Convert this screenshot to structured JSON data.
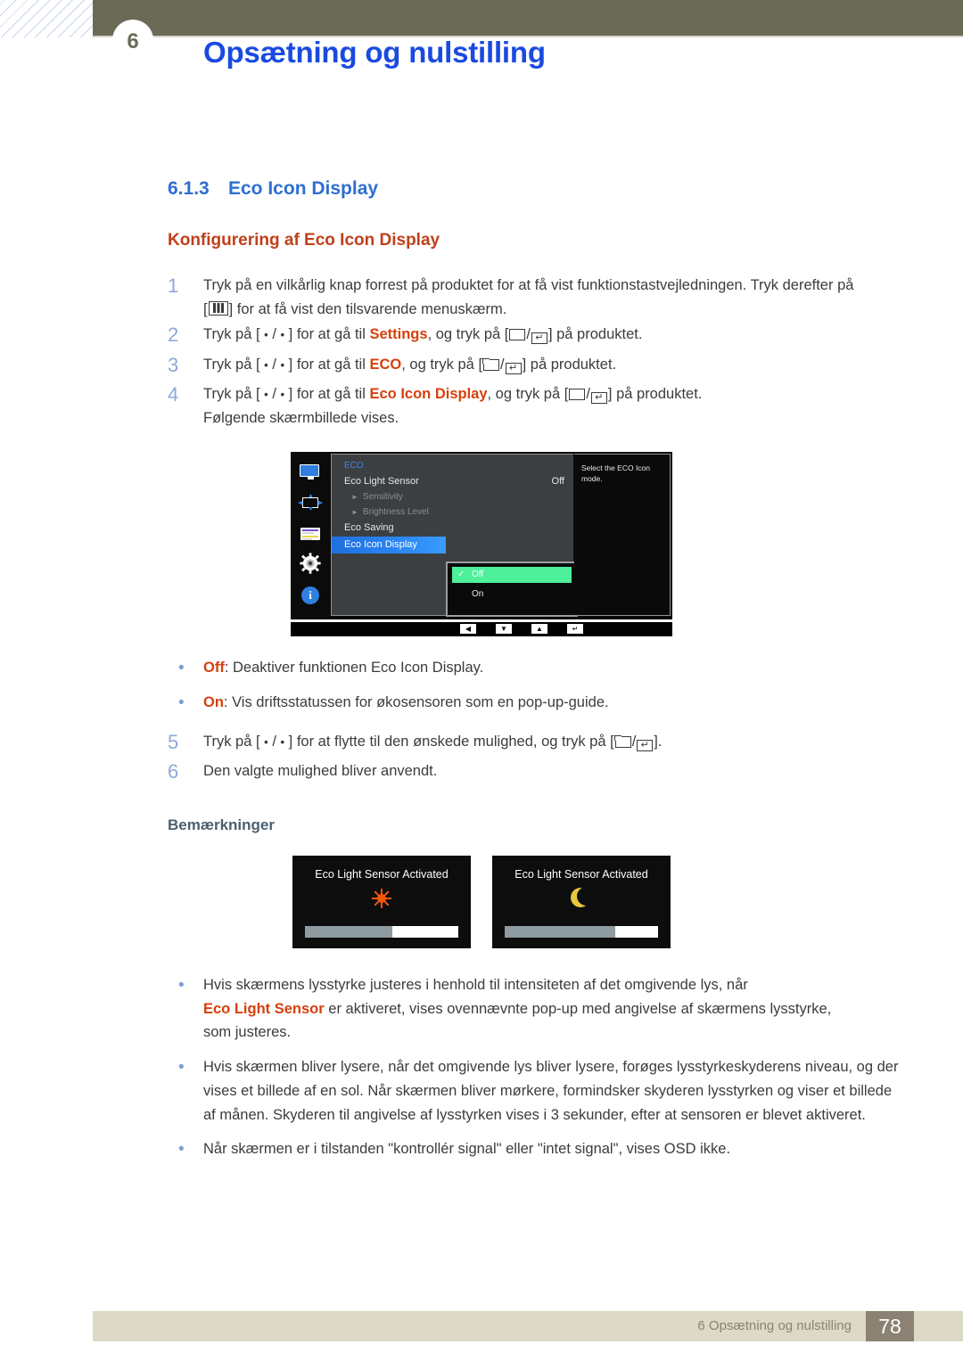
{
  "header": {
    "chapter_number": "6",
    "title": "Opsætning og nulstilling"
  },
  "section": {
    "number": "6.1.3",
    "title": "Eco Icon Display",
    "subtitle": "Konfigurering af Eco Icon Display"
  },
  "steps": [
    {
      "num": "1",
      "line1_a": "Tryk på en vilkårlig knap forrest på produktet for at få vist funktionstastvejledningen. Tryk derefter på",
      "line2_a": "[",
      "line2_b": "] for at få vist den tilsvarende menuskærm."
    },
    {
      "num": "2",
      "pre": "Tryk på [",
      "mid": "/",
      "post": "] for at gå til ",
      "target": "Settings",
      "tail_a": ", og tryk på [",
      "tail_b": "/",
      "tail_c": "] på produktet."
    },
    {
      "num": "3",
      "pre": "Tryk på [",
      "mid": "/",
      "post": "] for at gå til ",
      "target": "ECO",
      "tail_a": ", og tryk på [",
      "tail_b": "/",
      "tail_c": "] på produktet."
    },
    {
      "num": "4",
      "pre": "Tryk på [",
      "mid": "/",
      "post": "] for at gå til ",
      "target": "Eco Icon Display",
      "tail_a": ", og tryk på [",
      "tail_b": "/",
      "tail_c": "] på produktet.",
      "follow": "Følgende skærmbillede vises."
    },
    {
      "num": "5",
      "pre": "Tryk på [",
      "mid": "/",
      "post": "] for at flytte til den ønskede mulighed, og tryk på [",
      "tail_b": "/",
      "tail_c": "]."
    },
    {
      "num": "6",
      "plain": "Den valgte mulighed bliver anvendt."
    }
  ],
  "option_bullets": [
    {
      "label": "Off",
      "text": ": Deaktiver funktionen Eco Icon Display."
    },
    {
      "label": "On",
      "text": ": Vis driftsstatussen for økosensoren som en pop-up-guide."
    }
  ],
  "osd": {
    "menu_title": "ECO",
    "rows": [
      {
        "label": "Eco Light Sensor",
        "value": "Off",
        "type": "normal"
      },
      {
        "label": "Sensitivity",
        "value": "",
        "type": "sub"
      },
      {
        "label": "Brightness Level",
        "value": "",
        "type": "sub"
      },
      {
        "label": "Eco Saving",
        "value": "",
        "type": "normal"
      },
      {
        "label": "Eco Icon Display",
        "value": "",
        "type": "selected"
      }
    ],
    "dropdown": [
      {
        "label": "Off",
        "checked": true
      },
      {
        "label": "On",
        "checked": false
      }
    ],
    "help_text": "Select the ECO Icon mode.",
    "nav_buttons": [
      "◀",
      "▼",
      "▲",
      "↵"
    ],
    "side_icons": [
      "monitor-icon",
      "position-icon",
      "onscreen-display-icon",
      "setup-gear-icon",
      "information-icon"
    ],
    "colors": {
      "highlight_blue": "#2f7fe0",
      "dropdown_green": "#4ef09a",
      "panel_gray": "#3c3f41",
      "title_blue": "#3f85e8"
    }
  },
  "notes_heading": "Bemærkninger",
  "popups": [
    {
      "title": "Eco Light Sensor Activated",
      "icon": "sun-icon",
      "fill_percent": 57
    },
    {
      "title": "Eco Light Sensor Activated",
      "icon": "moon-icon",
      "fill_percent": 72
    }
  ],
  "note_bullets": [
    {
      "line1": "Hvis skærmens lysstyrke justeres i henhold til intensiteten af det omgivende lys, når",
      "highlight": "Eco Light Sensor",
      "line2": " er aktiveret, vises ovennævnte pop-up med angivelse af skærmens lysstyrke,",
      "line3": "som justeres."
    },
    {
      "text": "Hvis skærmen bliver lysere, når det omgivende lys bliver lysere, forøges lysstyrkeskyderens niveau, og der vises et billede af en sol. Når skærmen bliver mørkere, formindsker skyderen lysstyrken og viser et billede af månen. Skyderen til angivelse af lysstyrken vises i 3 sekunder, efter at sensoren er blevet aktiveret."
    },
    {
      "text": "Når skærmen er i tilstanden \"kontrollér signal\" eller \"intet signal\", vises OSD ikke."
    }
  ],
  "footer": {
    "text": "6 Opsætning og nulstilling",
    "page": "78"
  }
}
